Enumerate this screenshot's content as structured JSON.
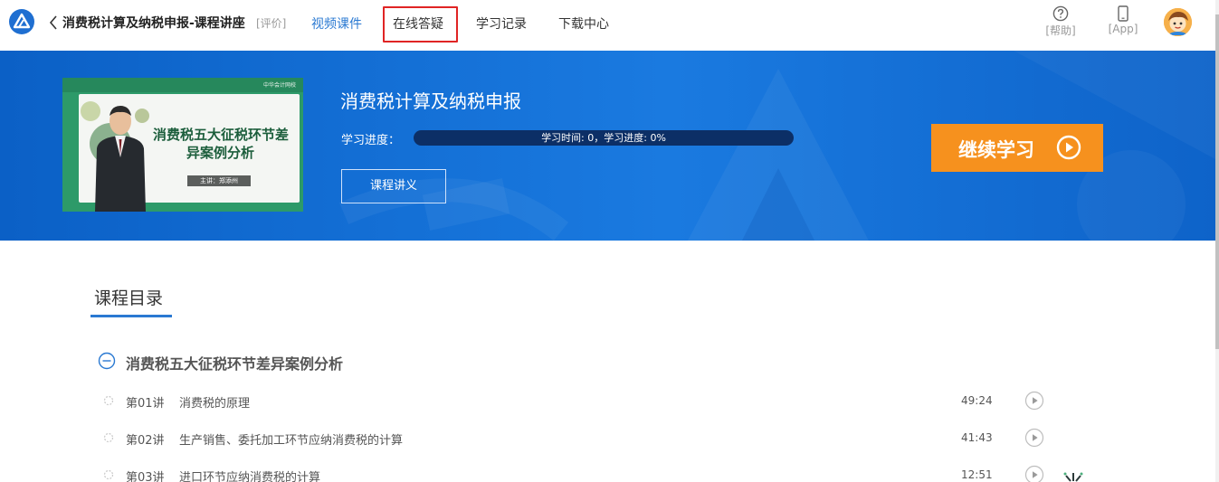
{
  "header": {
    "course_title": "消费税计算及纳税申报-课程讲座",
    "rate_link": "[评价]",
    "tabs": [
      {
        "label": "视频课件",
        "active": true
      },
      {
        "label": "在线答疑",
        "active": false
      },
      {
        "label": "学习记录",
        "active": false
      },
      {
        "label": "下载中心",
        "active": false
      }
    ],
    "help_label": "[帮助]",
    "app_label": "[App]",
    "accent_color": "#2a79d2",
    "highlight_color": "#e02424"
  },
  "banner": {
    "thumbnail": {
      "title_line1": "消费税五大征税环节差",
      "title_line2": "异案例分析",
      "speaker": "主讲：郑添州",
      "brand": "中华会计网校"
    },
    "title": "消费税计算及纳税申报",
    "progress_label": "学习进度：",
    "progress_text": "学习时间: 0，学习进度: 0%",
    "progress_percent": 0,
    "handout_button": "课程讲义",
    "continue_button": "继续学习",
    "continue_color": "#f6911e"
  },
  "catalog": {
    "title": "课程目录",
    "chapter_title": "消费税五大征税环节差异案例分析",
    "lectures": [
      {
        "number": "第01讲",
        "name": "消费税的原理",
        "duration": "49:24"
      },
      {
        "number": "第02讲",
        "name": "生产销售、委托加工环节应纳消费税的计算",
        "duration": "41:43"
      },
      {
        "number": "第03讲",
        "name": "进口环节应纳消费税的计算",
        "duration": "12:51"
      }
    ]
  }
}
